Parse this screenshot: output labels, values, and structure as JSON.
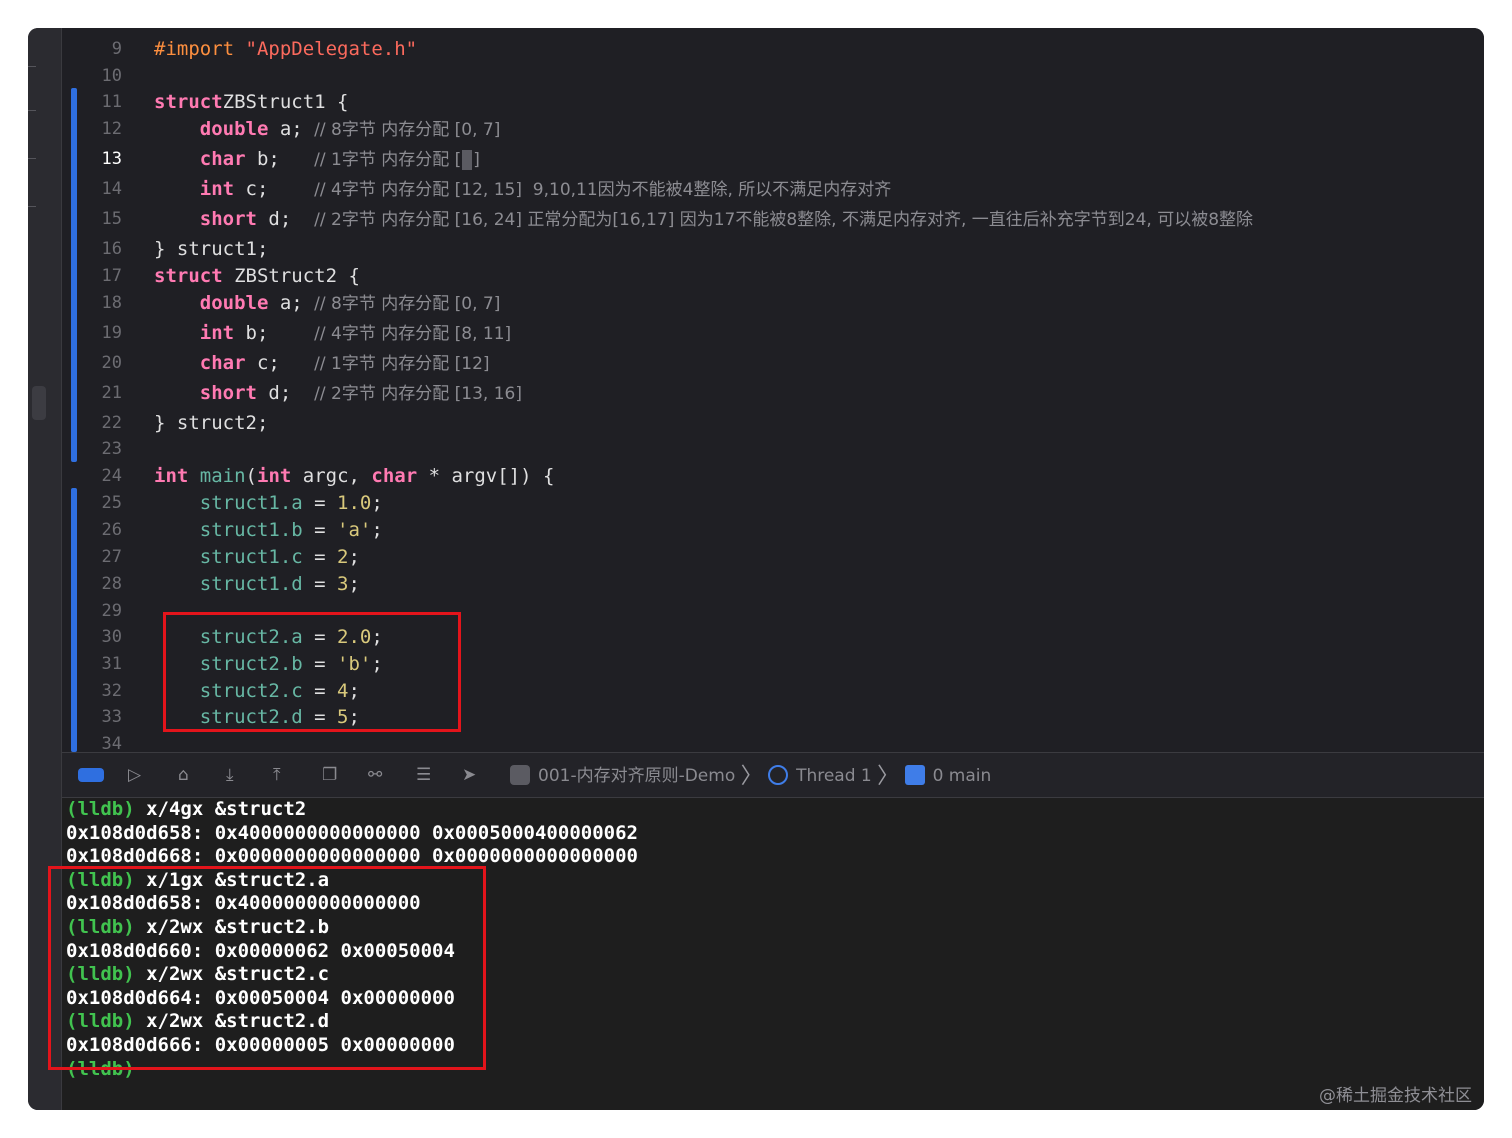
{
  "editor": {
    "current_line": "13",
    "lines": [
      {
        "n": "9",
        "parts": [
          [
            "pre",
            "#import "
          ],
          [
            "str",
            "\"AppDelegate.h\""
          ]
        ]
      },
      {
        "n": "10",
        "parts": []
      },
      {
        "n": "11",
        "parts": [
          [
            "kw",
            "struct"
          ],
          [
            "",
            "ZBStruct1 {"
          ]
        ]
      },
      {
        "n": "12",
        "parts": [
          [
            "",
            "    "
          ],
          [
            "kw",
            "double"
          ],
          [
            "",
            " a; "
          ],
          [
            "cm",
            "// 8字节 内存分配 [0, 7]"
          ]
        ]
      },
      {
        "n": "13",
        "parts": [
          [
            "",
            "    "
          ],
          [
            "kw",
            "char"
          ],
          [
            "",
            " b;   "
          ],
          [
            "cm",
            "// 1字节 内存分配 ["
          ],
          [
            "cursor",
            ""
          ],
          [
            "cm",
            "]"
          ]
        ]
      },
      {
        "n": "14",
        "parts": [
          [
            "",
            "    "
          ],
          [
            "kw",
            "int"
          ],
          [
            "",
            " c;    "
          ],
          [
            "cm",
            "// 4字节 内存分配 [12, 15]  9,10,11因为不能被4整除, 所以不满足内存对齐"
          ]
        ]
      },
      {
        "n": "15",
        "parts": [
          [
            "",
            "    "
          ],
          [
            "kw",
            "short"
          ],
          [
            "",
            " d;  "
          ],
          [
            "cm",
            "// 2字节 内存分配 [16, 24] 正常分配为[16,17] 因为17不能被8整除, 不满足内存对齐, 一直往后补充字节到24, 可以被8整除"
          ]
        ]
      },
      {
        "n": "16",
        "parts": [
          [
            "",
            "} struct1;"
          ]
        ]
      },
      {
        "n": "17",
        "parts": [
          [
            "kw",
            "struct"
          ],
          [
            "",
            " ZBStruct2 {"
          ]
        ]
      },
      {
        "n": "18",
        "parts": [
          [
            "",
            "    "
          ],
          [
            "kw",
            "double"
          ],
          [
            "",
            " a; "
          ],
          [
            "cm",
            "// 8字节 内存分配 [0, 7]"
          ]
        ]
      },
      {
        "n": "19",
        "parts": [
          [
            "",
            "    "
          ],
          [
            "kw",
            "int"
          ],
          [
            "",
            " b;    "
          ],
          [
            "cm",
            "// 4字节 内存分配 [8, 11]"
          ]
        ]
      },
      {
        "n": "20",
        "parts": [
          [
            "",
            "    "
          ],
          [
            "kw",
            "char"
          ],
          [
            "",
            " c;   "
          ],
          [
            "cm",
            "// 1字节 内存分配 [12]"
          ]
        ]
      },
      {
        "n": "21",
        "parts": [
          [
            "",
            "    "
          ],
          [
            "kw",
            "short"
          ],
          [
            "",
            " d;  "
          ],
          [
            "cm",
            "// 2字节 内存分配 [13, 16]"
          ]
        ]
      },
      {
        "n": "22",
        "parts": [
          [
            "",
            "} struct2;"
          ]
        ]
      },
      {
        "n": "23",
        "parts": []
      },
      {
        "n": "24",
        "parts": [
          [
            "kw",
            "int"
          ],
          [
            "",
            " "
          ],
          [
            "fn",
            "main"
          ],
          [
            "",
            "("
          ],
          [
            "kw",
            "int"
          ],
          [
            "",
            " argc, "
          ],
          [
            "kw",
            "char"
          ],
          [
            "",
            " * argv[]) {"
          ]
        ]
      },
      {
        "n": "25",
        "parts": [
          [
            "",
            "    "
          ],
          [
            "mem",
            "struct1.a"
          ],
          [
            "",
            " = "
          ],
          [
            "num",
            "1.0"
          ],
          [
            "",
            ";"
          ]
        ]
      },
      {
        "n": "26",
        "parts": [
          [
            "",
            "    "
          ],
          [
            "mem",
            "struct1.b"
          ],
          [
            "",
            " = "
          ],
          [
            "chr",
            "'a'"
          ],
          [
            "",
            ";"
          ]
        ]
      },
      {
        "n": "27",
        "parts": [
          [
            "",
            "    "
          ],
          [
            "mem",
            "struct1.c"
          ],
          [
            "",
            " = "
          ],
          [
            "num",
            "2"
          ],
          [
            "",
            ";"
          ]
        ]
      },
      {
        "n": "28",
        "parts": [
          [
            "",
            "    "
          ],
          [
            "mem",
            "struct1.d"
          ],
          [
            "",
            " = "
          ],
          [
            "num",
            "3"
          ],
          [
            "",
            ";"
          ]
        ]
      },
      {
        "n": "29",
        "parts": []
      },
      {
        "n": "30",
        "parts": [
          [
            "",
            "    "
          ],
          [
            "mem",
            "struct2.a"
          ],
          [
            "",
            " = "
          ],
          [
            "num",
            "2.0"
          ],
          [
            "",
            ";"
          ]
        ]
      },
      {
        "n": "31",
        "parts": [
          [
            "",
            "    "
          ],
          [
            "mem",
            "struct2.b"
          ],
          [
            "",
            " = "
          ],
          [
            "chr",
            "'b'"
          ],
          [
            "",
            ";"
          ]
        ]
      },
      {
        "n": "32",
        "parts": [
          [
            "",
            "    "
          ],
          [
            "mem",
            "struct2.c"
          ],
          [
            "",
            " = "
          ],
          [
            "num",
            "4"
          ],
          [
            "",
            ";"
          ]
        ]
      },
      {
        "n": "33",
        "parts": [
          [
            "",
            "    "
          ],
          [
            "mem",
            "struct2.d"
          ],
          [
            "",
            " = "
          ],
          [
            "num",
            "5"
          ],
          [
            "",
            ";"
          ]
        ]
      },
      {
        "n": "34",
        "parts": []
      }
    ]
  },
  "debug_bar": {
    "scheme": "001-内存对齐原则-Demo",
    "thread": "Thread 1",
    "frame": "0 main"
  },
  "console": {
    "lines": [
      {
        "prompt": "(lldb)",
        "text": " x/4gx &struct2"
      },
      {
        "prompt": "",
        "text": "0x108d0d658: 0x4000000000000000 0x0005000400000062"
      },
      {
        "prompt": "",
        "text": "0x108d0d668: 0x0000000000000000 0x0000000000000000"
      },
      {
        "prompt": "(lldb)",
        "text": " x/1gx &struct2.a"
      },
      {
        "prompt": "",
        "text": "0x108d0d658: 0x4000000000000000"
      },
      {
        "prompt": "(lldb)",
        "text": " x/2wx &struct2.b"
      },
      {
        "prompt": "",
        "text": "0x108d0d660: 0x00000062 0x00050004"
      },
      {
        "prompt": "(lldb)",
        "text": " x/2wx &struct2.c"
      },
      {
        "prompt": "",
        "text": "0x108d0d664: 0x00050004 0x00000000"
      },
      {
        "prompt": "(lldb)",
        "text": " x/2wx &struct2.d"
      },
      {
        "prompt": "",
        "text": "0x108d0d666: 0x00000005 0x00000000"
      },
      {
        "prompt": "(lldb)",
        "text": ""
      }
    ]
  },
  "watermark": "@稀土掘金技术社区",
  "colors": {
    "highlight_box": "#e3141b",
    "change_bar": "#2f6fe0",
    "prompt": "#41c34f"
  }
}
